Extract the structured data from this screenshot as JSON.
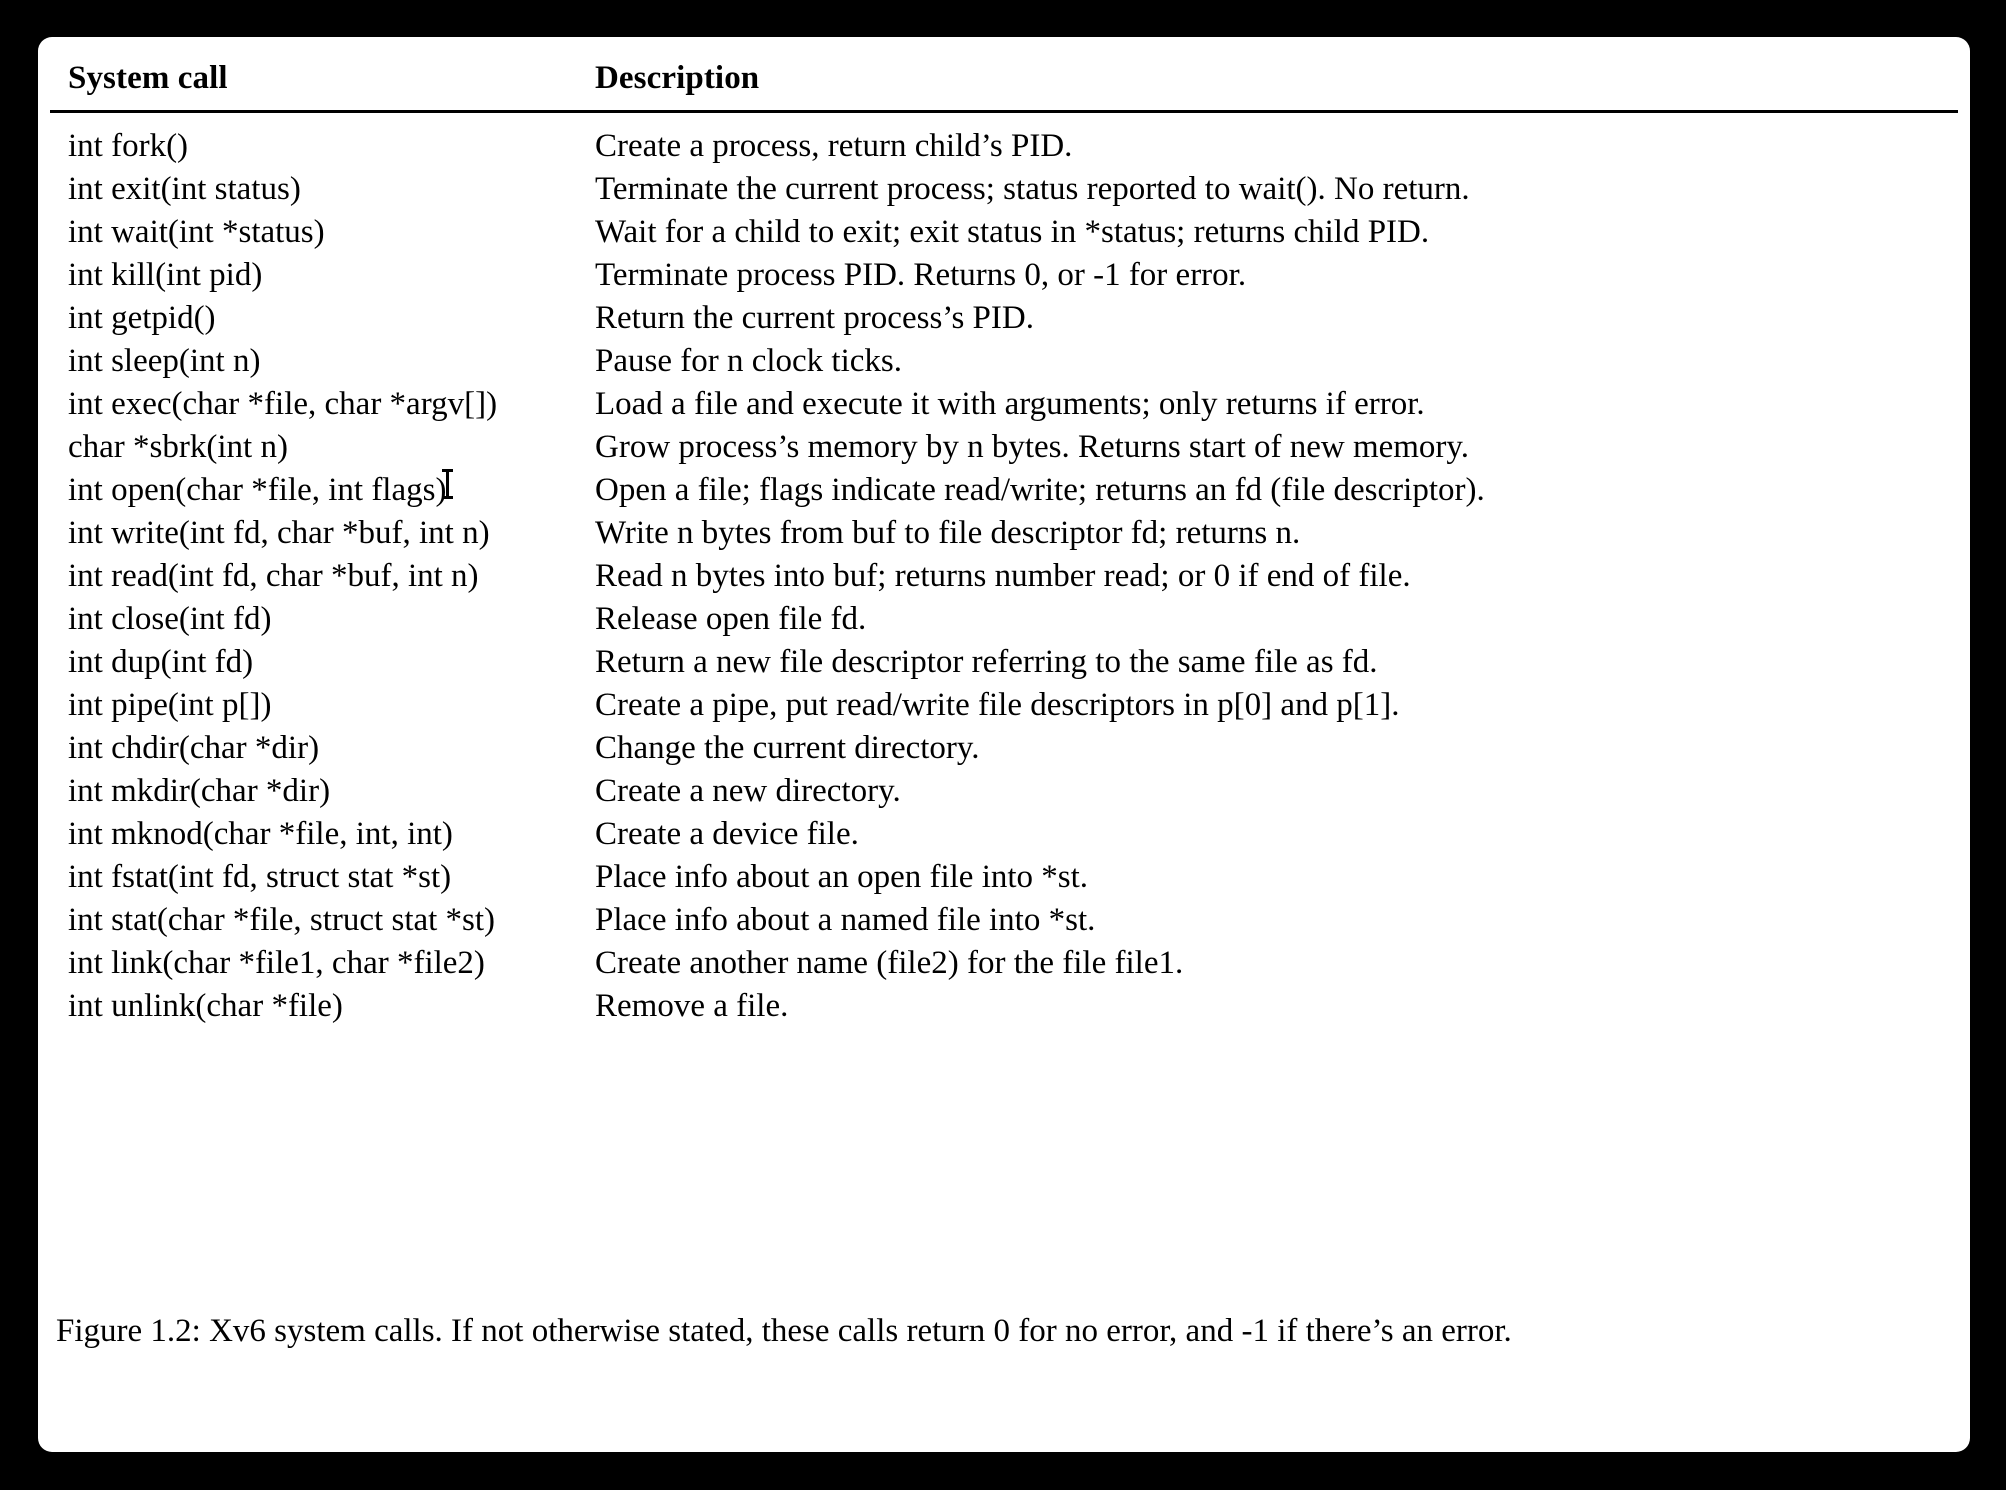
{
  "figure": {
    "panel_background": "#ffffff",
    "page_background": "#000000",
    "text_color": "#000000",
    "caption": "Figure 1.2: Xv6 system calls. If not otherwise stated, these calls return 0 for no error, and -1 if there’s an error."
  },
  "table": {
    "headers": {
      "call": "System call",
      "description": "Description"
    },
    "rows": [
      {
        "call": "int fork()",
        "description": "Create a process, return child’s PID."
      },
      {
        "call": "int exit(int status)",
        "description": "Terminate the current process; status reported to wait(). No return."
      },
      {
        "call": "int wait(int *status)",
        "description": "Wait for a child to exit; exit status in *status; returns child PID."
      },
      {
        "call": "int kill(int pid)",
        "description": "Terminate process PID. Returns 0, or -1 for error."
      },
      {
        "call": "int getpid()",
        "description": "Return the current process’s PID."
      },
      {
        "call": "int sleep(int n)",
        "description": "Pause for n clock ticks."
      },
      {
        "call": "int exec(char *file, char *argv[])",
        "description": "Load a file and execute it with arguments; only returns if error."
      },
      {
        "call": "char *sbrk(int n)",
        "description": "Grow process’s memory by n bytes. Returns start of new memory."
      },
      {
        "call": "int open(char *file, int flags)",
        "description": "Open a file; flags indicate read/write; returns an fd (file descriptor)."
      },
      {
        "call": "int write(int fd, char *buf, int n)",
        "description": "Write n bytes from buf to file descriptor fd; returns n."
      },
      {
        "call": "int read(int fd, char *buf, int n)",
        "description": "Read n bytes into buf; returns number read; or 0 if end of file."
      },
      {
        "call": "int close(int fd)",
        "description": "Release open file fd."
      },
      {
        "call": "int dup(int fd)",
        "description": "Return a new file descriptor referring to the same file as fd."
      },
      {
        "call": "int pipe(int p[])",
        "description": "Create a pipe, put read/write file descriptors in p[0] and p[1]."
      },
      {
        "call": "int chdir(char *dir)",
        "description": "Change the current directory."
      },
      {
        "call": "int mkdir(char *dir)",
        "description": "Create a new directory."
      },
      {
        "call": "int mknod(char *file, int, int)",
        "description": "Create a device file."
      },
      {
        "call": "int fstat(int fd, struct stat *st)",
        "description": "Place info about an open file into *st."
      },
      {
        "call": "int stat(char *file, struct stat *st)",
        "description": "Place info about a named file into *st."
      },
      {
        "call": "int link(char *file1, char *file2)",
        "description": "Create another name (file2) for the file file1."
      },
      {
        "call": "int unlink(char *file)",
        "description": "Remove a file."
      }
    ]
  },
  "cursor": {
    "type": "text-ibeam-cursor"
  }
}
